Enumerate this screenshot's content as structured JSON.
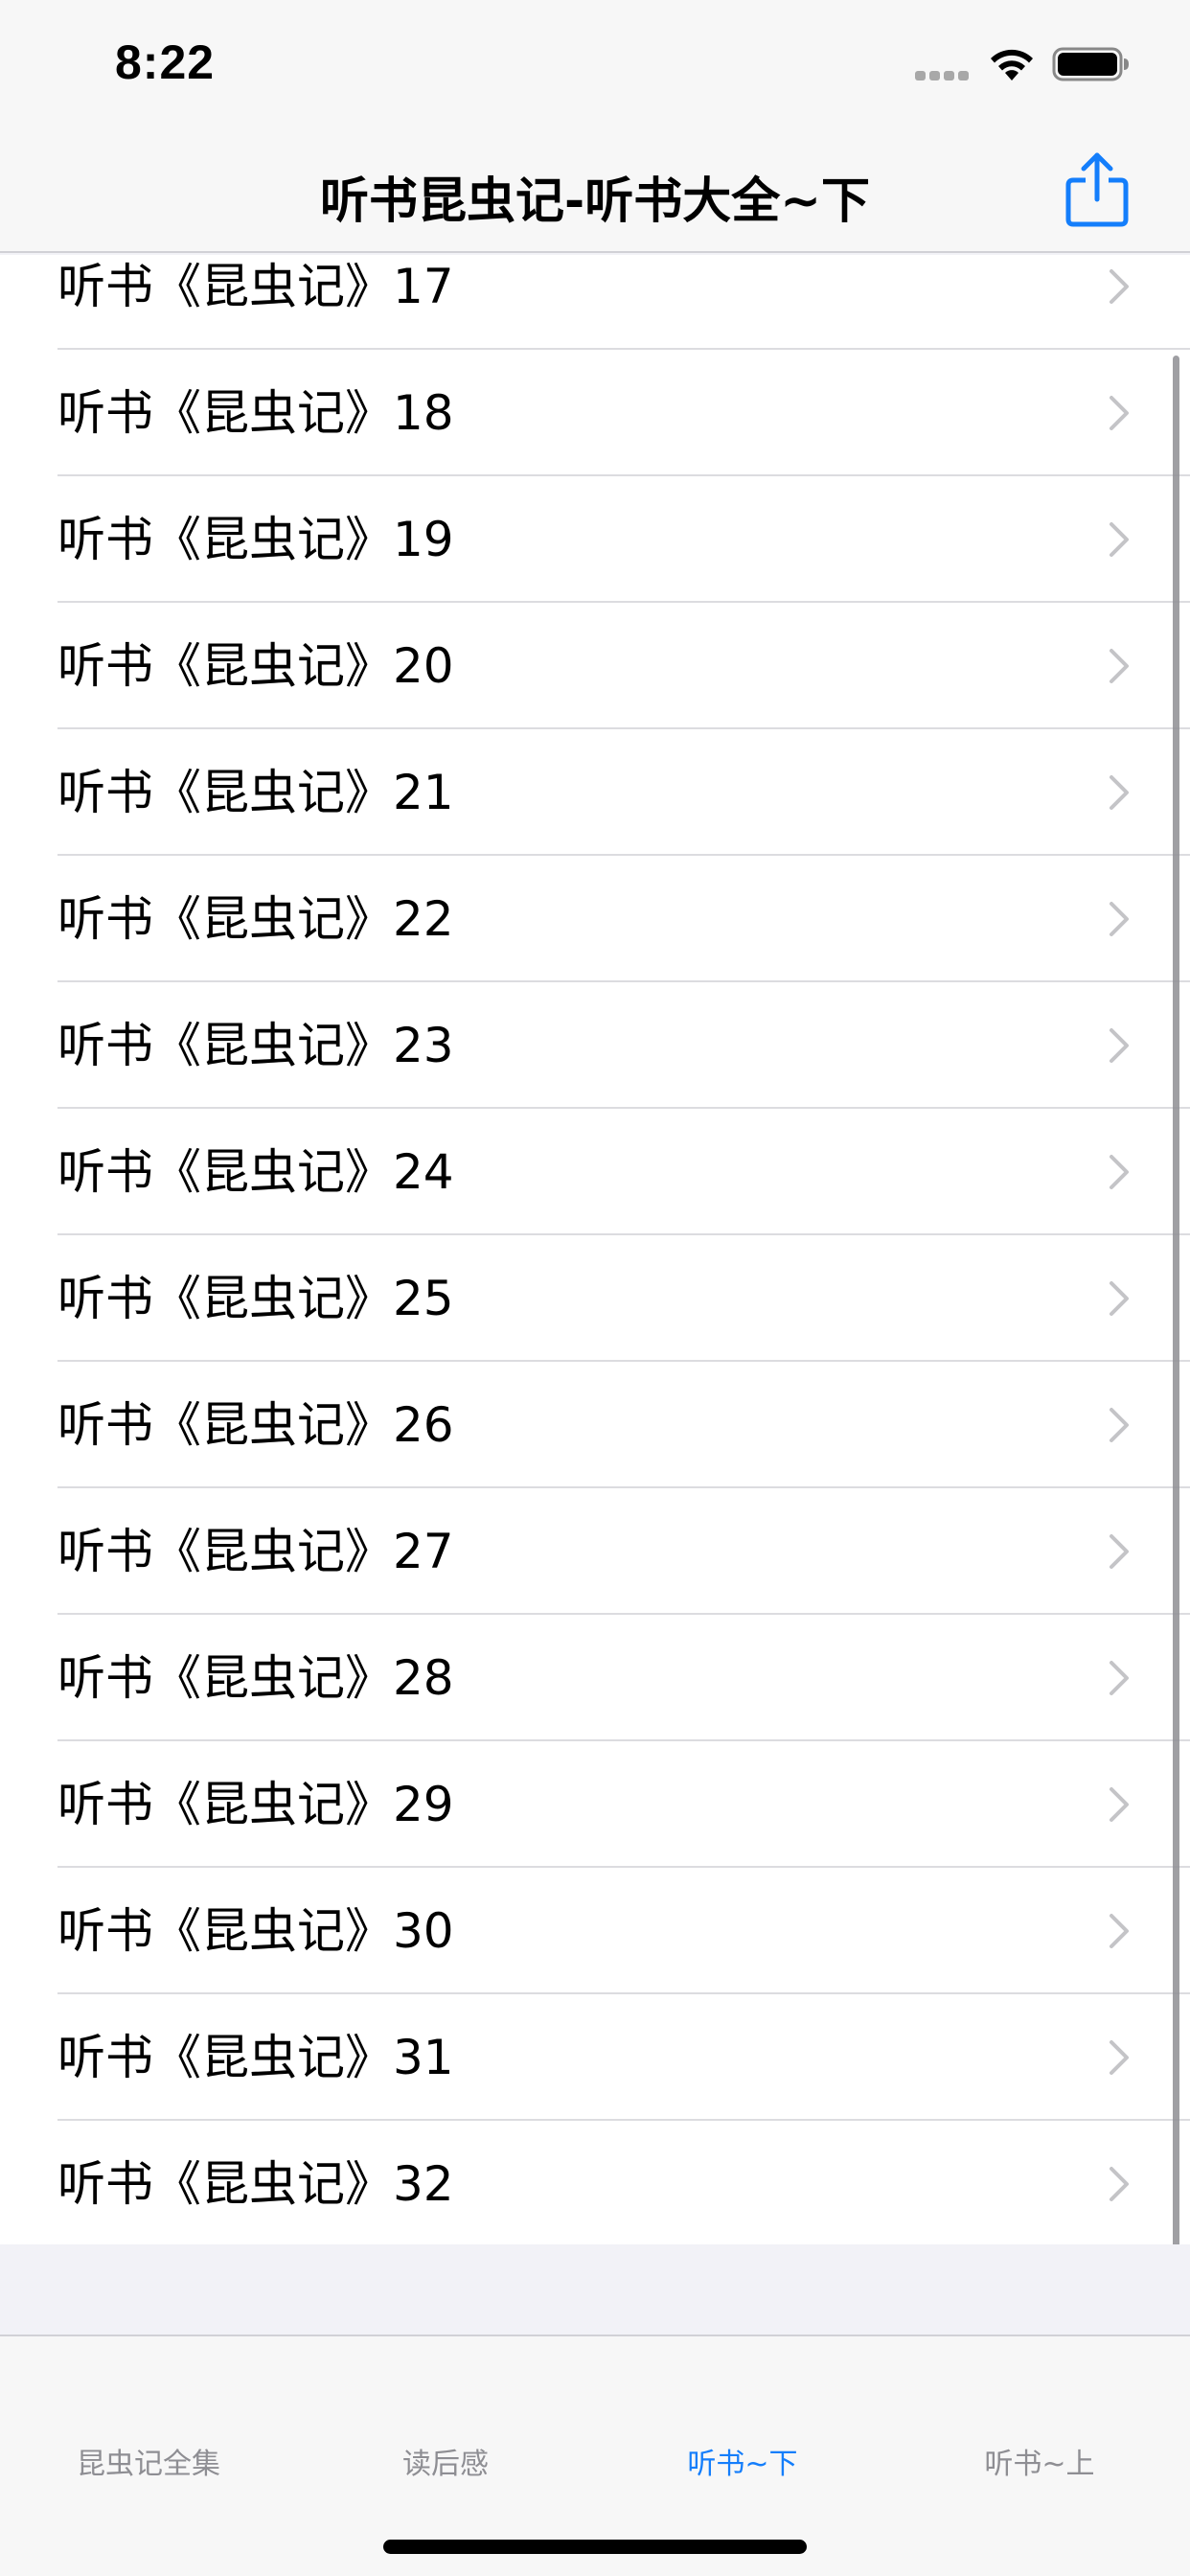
{
  "status_bar": {
    "time": "8:22"
  },
  "nav": {
    "title": "听书昆虫记-听书大全~下",
    "share_icon": "share-icon",
    "accent": "#147efb"
  },
  "list": {
    "items": [
      {
        "label": "听书《昆虫记》17"
      },
      {
        "label": "听书《昆虫记》18"
      },
      {
        "label": "听书《昆虫记》19"
      },
      {
        "label": "听书《昆虫记》20"
      },
      {
        "label": "听书《昆虫记》21"
      },
      {
        "label": "听书《昆虫记》22"
      },
      {
        "label": "听书《昆虫记》23"
      },
      {
        "label": "听书《昆虫记》24"
      },
      {
        "label": "听书《昆虫记》25"
      },
      {
        "label": "听书《昆虫记》26"
      },
      {
        "label": "听书《昆虫记》27"
      },
      {
        "label": "听书《昆虫记》28"
      },
      {
        "label": "听书《昆虫记》29"
      },
      {
        "label": "听书《昆虫记》30"
      },
      {
        "label": "听书《昆虫记》31"
      },
      {
        "label": "听书《昆虫记》32"
      }
    ]
  },
  "tab_bar": {
    "tabs": [
      {
        "label": "昆虫记全集",
        "active": false
      },
      {
        "label": "读后感",
        "active": false
      },
      {
        "label": "听书~下",
        "active": true
      },
      {
        "label": "听书~上",
        "active": false
      }
    ],
    "active_color": "#147efb",
    "inactive_color": "#8e8e93"
  }
}
